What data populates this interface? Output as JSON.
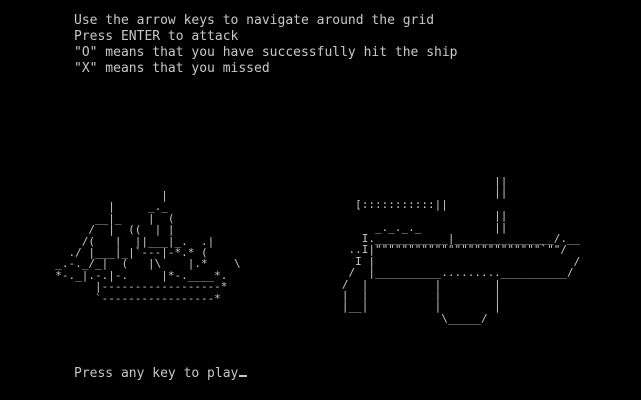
{
  "instructions": [
    "Use the arrow keys to navigate around the grid",
    "Press ENTER to attack",
    "\"O\" means that you have successfully hit the ship",
    "\"X\" means that you missed"
  ],
  "art": {
    "sailing_ship": "                  |\n          |     _._\n        __|_    |  (\n       /  |  ((  | |\n      /(   |  ||___|_.  .|\n    ./ |___|_|`---|-*.* (\n  _.-._/_|  (   |\\    |.*    \\\n  *-._|.-.|-.     |*-.____*.\n        |------------------*\n        `-----------------*",
    "battleship": "                          ||\n                          ||\n     [:::::::::::||\n                          ||\n        _._._._           ||\n      I.___________|_______________/.__\n    ..I|\"\"\"\"\"\"\"\"\"\"\"\"\"\"\"\"\"\"\"\"\"\"\"\"\"`\"\"/\n     I |                              /\n    /  |__________.........__________/\n   /  |          |        |\n   |  |          |        |\n   |__|          |        |\n                  \\_____/"
  },
  "prompt": "Press any key to play"
}
